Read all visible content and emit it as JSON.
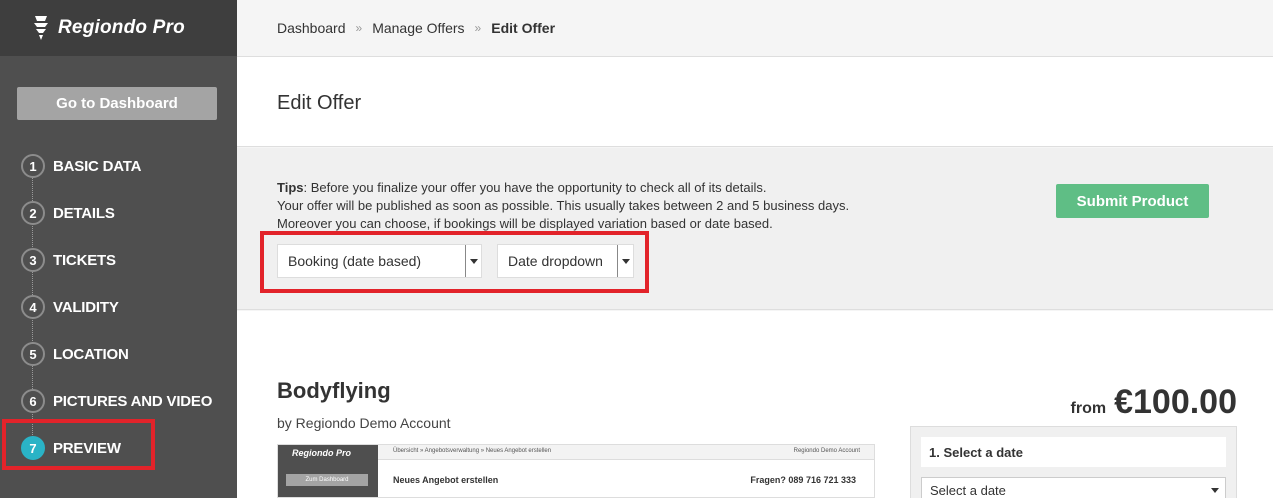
{
  "sidebar": {
    "logo": "Regiondo Pro",
    "dashboard_button": "Go to Dashboard",
    "steps": [
      {
        "num": "1",
        "label": "BASIC DATA"
      },
      {
        "num": "2",
        "label": "DETAILS"
      },
      {
        "num": "3",
        "label": "TICKETS"
      },
      {
        "num": "4",
        "label": "VALIDITY"
      },
      {
        "num": "5",
        "label": "LOCATION"
      },
      {
        "num": "6",
        "label": "PICTURES AND VIDEO"
      },
      {
        "num": "7",
        "label": "PREVIEW"
      }
    ],
    "active_step": 7
  },
  "breadcrumb": {
    "items": [
      "Dashboard",
      "Manage Offers",
      "Edit Offer"
    ],
    "separator": "»"
  },
  "page": {
    "title": "Edit Offer"
  },
  "tips": {
    "label": "Tips",
    "line1": ": Before you finalize your offer you have the opportunity to check all of its details.",
    "line2": "Your offer will be published as soon as possible. This usually takes between 2 and 5 business days.",
    "line3": "Moreover you can choose, if bookings will be displayed variation based or date based.",
    "booking_select": "Booking (date based)",
    "date_select": "Date dropdown",
    "submit_button": "Submit Product"
  },
  "product": {
    "title": "Bodyflying",
    "by": "by Regiondo Demo Account",
    "price_from": "from",
    "price_value": "€100.00"
  },
  "preview_screenshot": {
    "logo": "Regiondo Pro",
    "button": "Zum Dashboard",
    "breadcrumb": "Übersicht  »  Angebotsverwaltung  »  Neues Angebot erstellen",
    "user": "Regiondo Demo Account",
    "title": "Neues Angebot erstellen",
    "phone": "Fragen? 089 716 721 333"
  },
  "booking": {
    "header": "1. Select a date",
    "select_placeholder": "Select a date"
  },
  "colors": {
    "sidebar_bg": "#4f4f4f",
    "active_step": "#2ab3c6",
    "submit_green": "#5fbe85",
    "highlight_red": "#e2232a"
  }
}
